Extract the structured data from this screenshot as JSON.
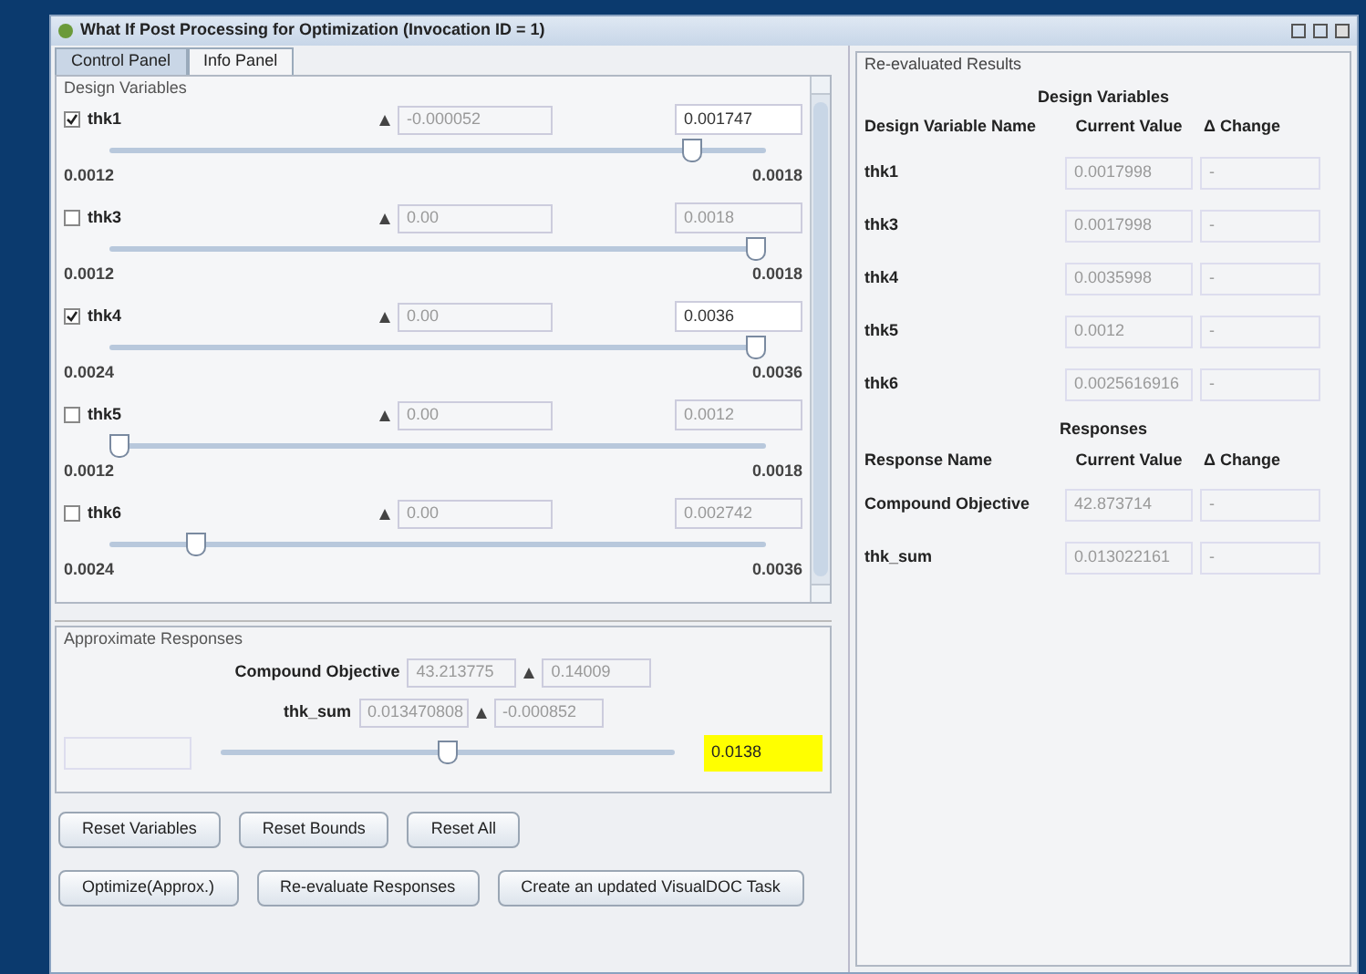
{
  "window": {
    "title": "What If Post Processing for Optimization (Invocation ID = 1)"
  },
  "tabs": [
    {
      "label": "Control Panel",
      "selected": true
    },
    {
      "label": "Info Panel",
      "selected": false
    }
  ],
  "design_variables": {
    "title": "Design Variables",
    "items": [
      {
        "name": "thk1",
        "checked": true,
        "delta": "-0.000052",
        "value": "0.001747",
        "min": "0.0012",
        "max": "0.0018",
        "level": 0.9
      },
      {
        "name": "thk3",
        "checked": false,
        "delta": "0.00",
        "value": "0.0018",
        "min": "0.0012",
        "max": "0.0018",
        "level": 1
      },
      {
        "name": "thk4",
        "checked": true,
        "delta": "0.00",
        "value": "0.0036",
        "min": "0.0024",
        "max": "0.0036",
        "level": 1
      },
      {
        "name": "thk5",
        "checked": false,
        "delta": "0.00",
        "value": "0.0012",
        "min": "0.0012",
        "max": "0.0018",
        "level": 0
      },
      {
        "name": "thk6",
        "checked": false,
        "delta": "0.00",
        "value": "0.002742",
        "min": "0.0024",
        "max": "0.0036",
        "level": 0.12
      }
    ]
  },
  "approximate_responses": {
    "title": "Approximate Responses",
    "items": [
      {
        "name": "Compound Objective",
        "value": "43.213775",
        "delta": "0.14009"
      },
      {
        "name": "thk_sum",
        "value": "0.013470808",
        "delta": "-0.000852"
      }
    ],
    "slider": {
      "level": 0.5,
      "value": "0.0138"
    }
  },
  "buttons": [
    [
      "Reset Variables",
      "Reset Bounds",
      "Reset All"
    ],
    [
      "Optimize(Approx.)",
      "Re-evaluate Responses",
      "Create an updated VisualDOC Task"
    ]
  ],
  "results": {
    "title": "Re-evaluated Results",
    "sections": [
      {
        "title": "Design Variables",
        "columns": [
          "Design Variable Name",
          "Current Value",
          "Δ Change"
        ],
        "rows": [
          {
            "name": "thk1",
            "value": "0.0017998",
            "change": "-"
          },
          {
            "name": "thk3",
            "value": "0.0017998",
            "change": "-"
          },
          {
            "name": "thk4",
            "value": "0.0035998",
            "change": "-"
          },
          {
            "name": "thk5",
            "value": "0.0012",
            "change": "-"
          },
          {
            "name": "thk6",
            "value": "0.0025616916",
            "change": "-"
          }
        ]
      },
      {
        "title": "Responses",
        "columns": [
          "Response Name",
          "Current Value",
          "Δ Change"
        ],
        "rows": [
          {
            "name": "Compound Objective",
            "value": "42.873714",
            "change": "-"
          },
          {
            "name": "thk_sum",
            "value": "0.013022161",
            "change": "-"
          }
        ]
      }
    ]
  }
}
